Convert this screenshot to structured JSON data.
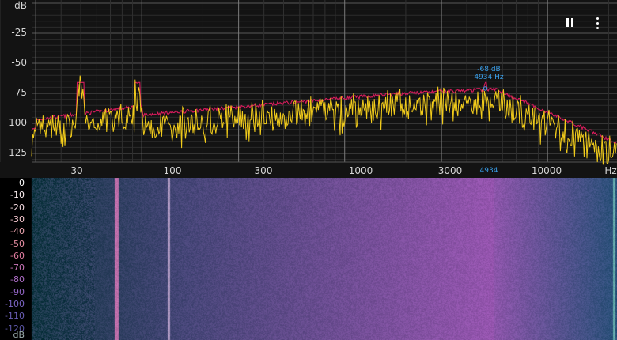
{
  "spectrum": {
    "y_unit": "dB",
    "y_ticks": [
      {
        "label": "-25",
        "db": -25
      },
      {
        "label": "-50",
        "db": -50
      },
      {
        "label": "-75",
        "db": -75
      },
      {
        "label": "-100",
        "db": -100
      },
      {
        "label": "-125",
        "db": -125
      }
    ],
    "x_unit": "Hz",
    "x_ticks": [
      {
        "label": "30",
        "hz": 30
      },
      {
        "label": "100",
        "hz": 100
      },
      {
        "label": "300",
        "hz": 300
      },
      {
        "label": "1000",
        "hz": 1000
      },
      {
        "label": "3000",
        "hz": 3000
      },
      {
        "label": "10000",
        "hz": 10000
      }
    ],
    "peak": {
      "db_label": "-68 dB",
      "hz_label": "4934 Hz",
      "x_marker": "4934",
      "hz": 4934,
      "db": -71
    },
    "colors": {
      "live": "#f2cc1b",
      "peak_hold": "#d81b5c",
      "marker": "#3a9ee8",
      "grid": "#4a4a4a"
    }
  },
  "controls": {
    "pause_icon": "pause-icon",
    "menu_icon": "more-vert-icon"
  },
  "spectrogram": {
    "unit": "dB",
    "scale": [
      {
        "label": "0",
        "color": "#ffffff"
      },
      {
        "label": "-10",
        "color": "#fbeef0"
      },
      {
        "label": "-20",
        "color": "#f6dbe1"
      },
      {
        "label": "-30",
        "color": "#f2c4cb"
      },
      {
        "label": "-40",
        "color": "#efa7b1"
      },
      {
        "label": "-50",
        "color": "#e98fa4"
      },
      {
        "label": "-60",
        "color": "#e27ca0"
      },
      {
        "label": "-70",
        "color": "#cd77bb"
      },
      {
        "label": "-80",
        "color": "#b06fc9"
      },
      {
        "label": "-90",
        "color": "#9567c9"
      },
      {
        "label": "-100",
        "color": "#7b64c2"
      },
      {
        "label": "-110",
        "color": "#6a5eb6"
      },
      {
        "label": "-120",
        "color": "#5c57a8"
      }
    ]
  }
}
